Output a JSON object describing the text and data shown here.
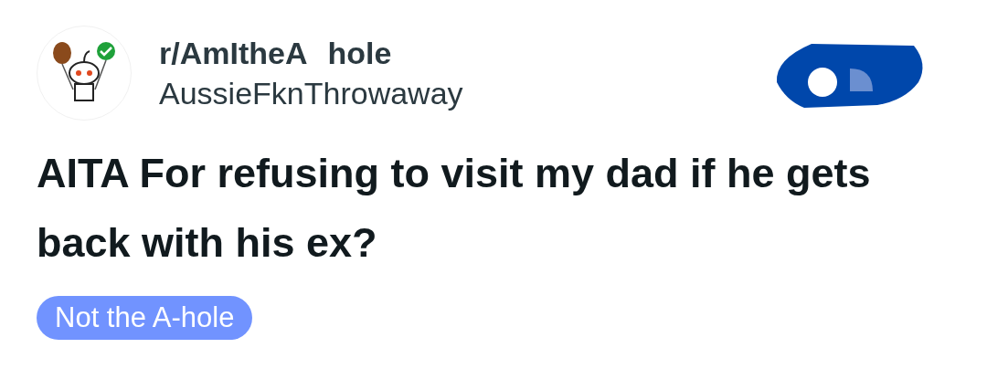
{
  "post": {
    "subreddit_parts": [
      "r/AmItheA",
      "hole"
    ],
    "author": "AussieFknThrowaway",
    "title": "AITA For refusing to visit my dad if he gets back with his ex?",
    "flair": {
      "label": "Not the A-hole",
      "color": "#7193ff"
    }
  }
}
